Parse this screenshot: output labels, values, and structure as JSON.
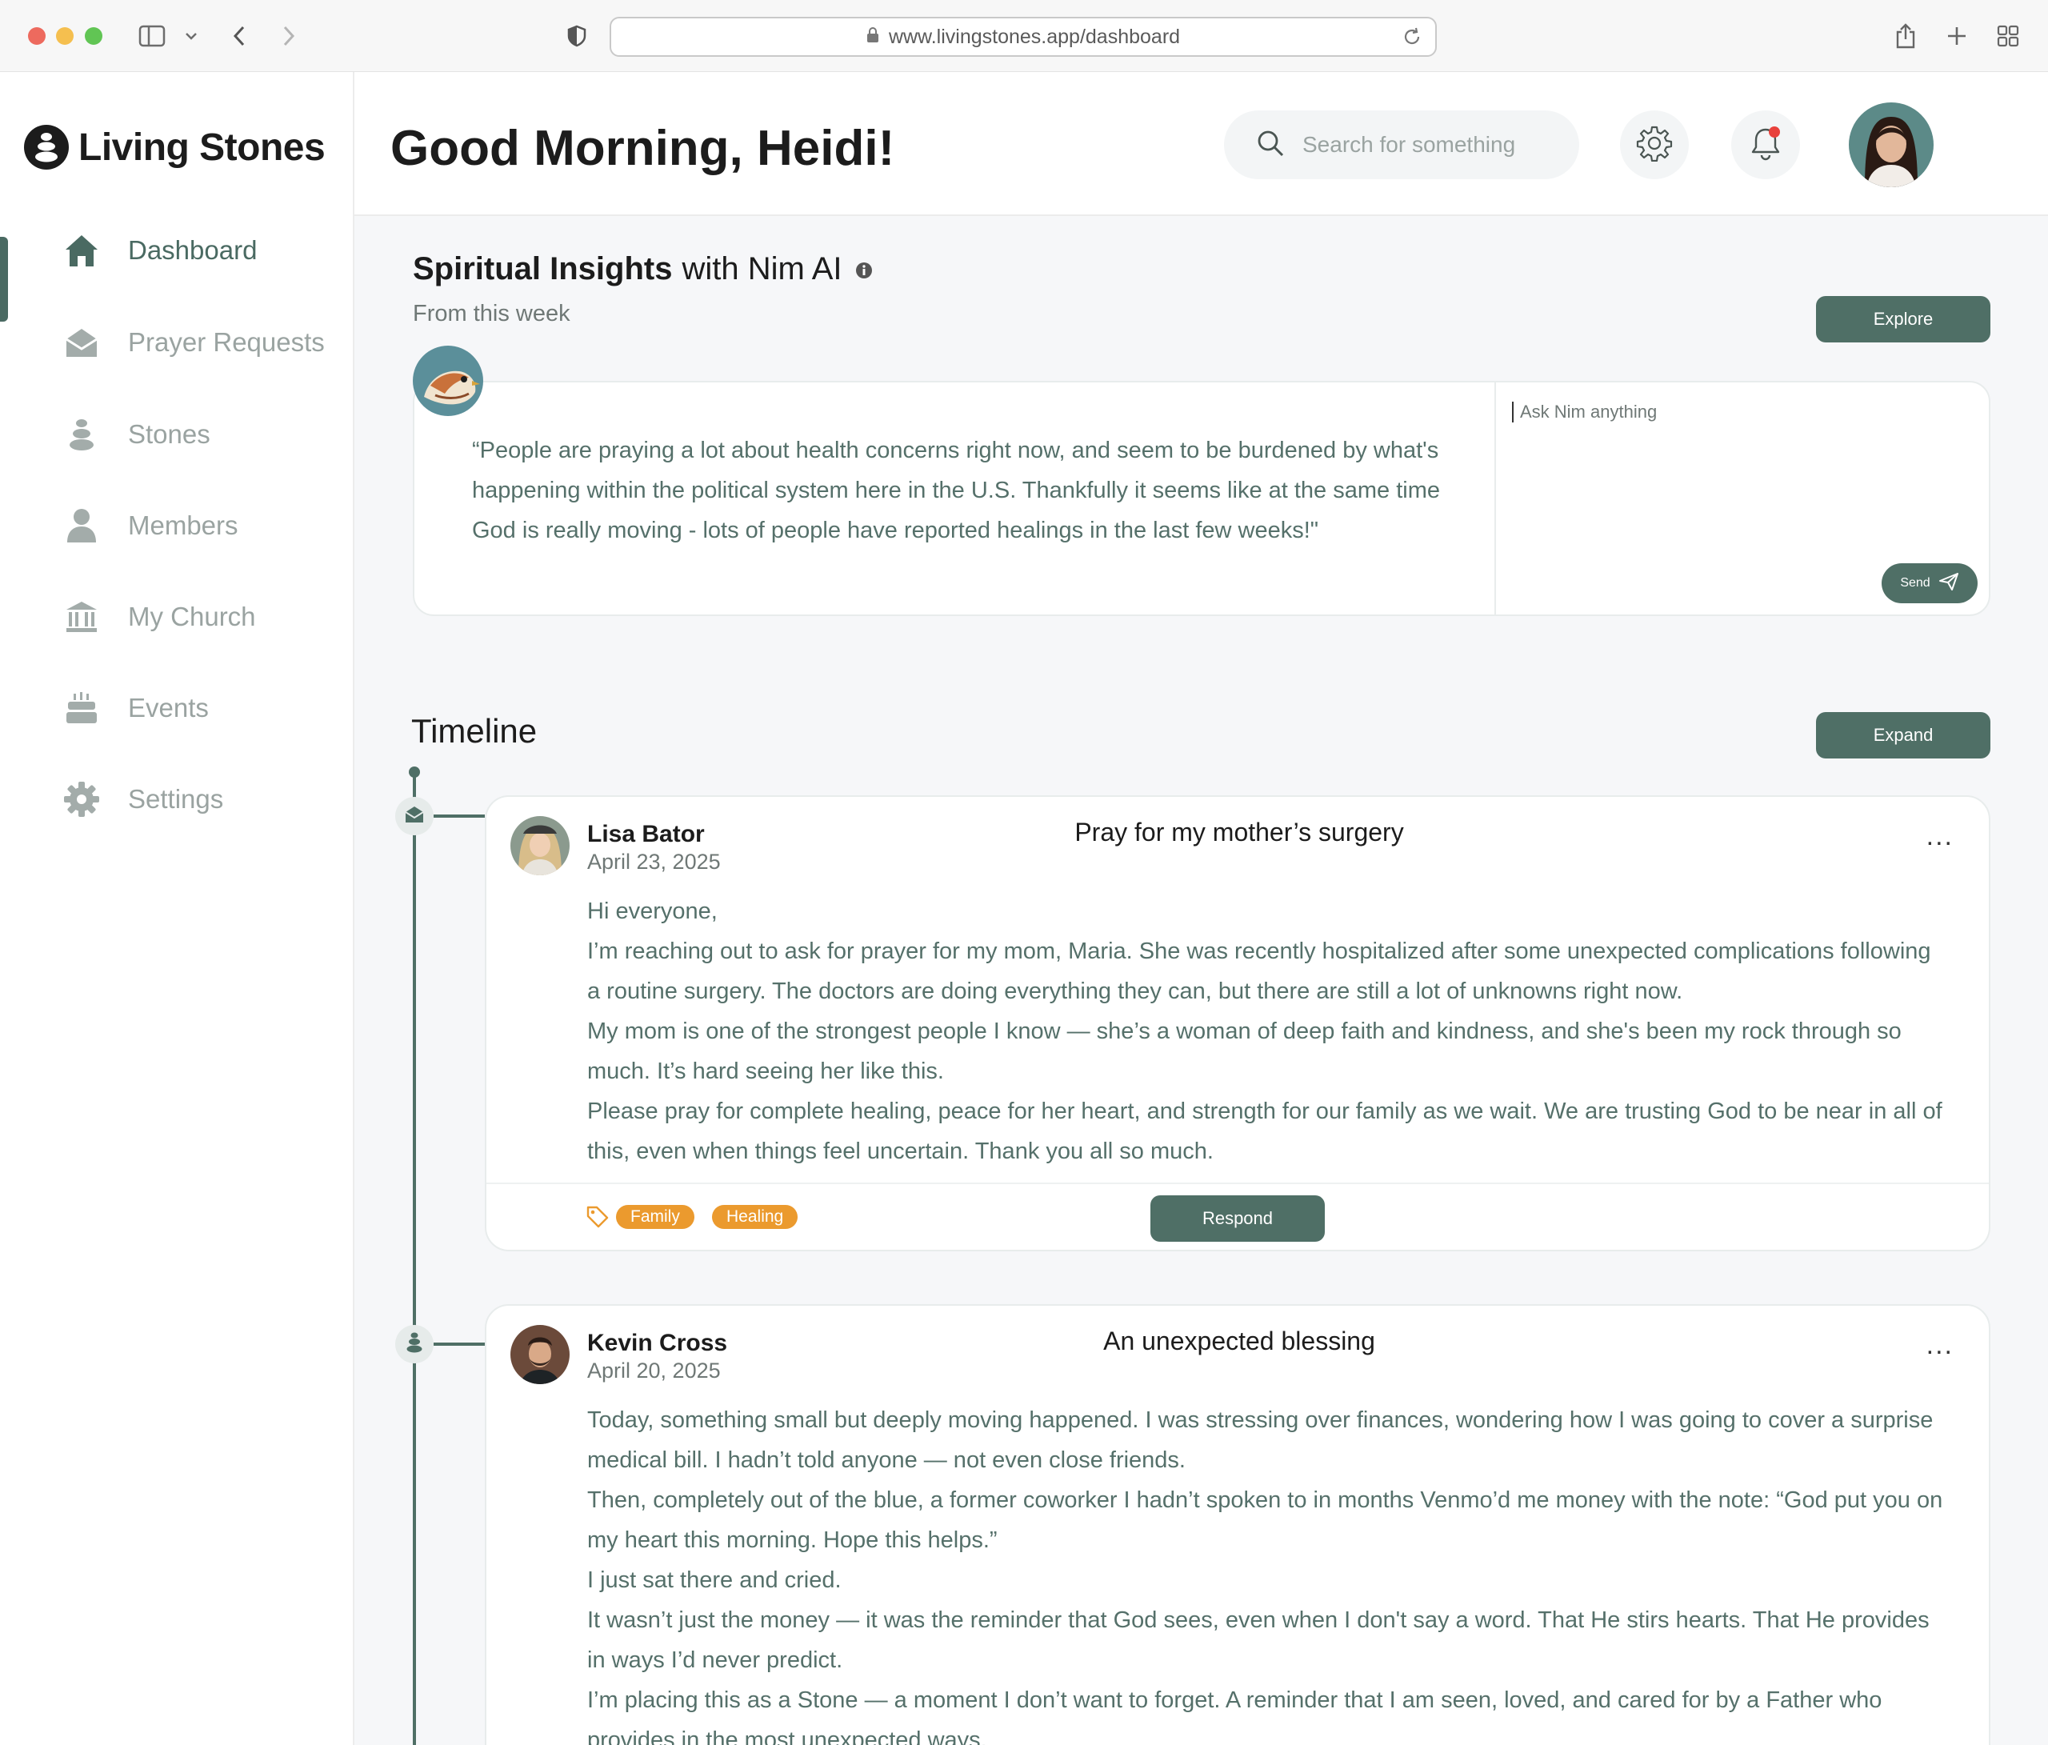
{
  "browser": {
    "url": "www.livingstones.app/dashboard"
  },
  "brand": {
    "name": "Living Stones",
    "accent": "#4f6f66",
    "tag_color": "#eb9a2e"
  },
  "sidebar": {
    "items": [
      {
        "label": "Dashboard",
        "icon": "home-icon",
        "active": true
      },
      {
        "label": "Prayer Requests",
        "icon": "envelope-icon",
        "active": false
      },
      {
        "label": "Stones",
        "icon": "stones-icon",
        "active": false
      },
      {
        "label": "Members",
        "icon": "person-icon",
        "active": false
      },
      {
        "label": "My Church",
        "icon": "church-icon",
        "active": false
      },
      {
        "label": "Events",
        "icon": "cake-icon",
        "active": false
      },
      {
        "label": "Settings",
        "icon": "gear-icon",
        "active": false
      }
    ]
  },
  "header": {
    "greeting": "Good Morning, Heidi!",
    "search_placeholder": "Search for something"
  },
  "insights": {
    "title_bold": "Spiritual Insights",
    "title_rest": "with Nim AI",
    "subtitle": "From this week",
    "explore_label": "Explore",
    "quote": "“People are praying a lot about health concerns right now, and seem to be burdened by what's happening within the political system here in the U.S. Thankfully it seems like at the same time God is really moving - lots of people have reported healings in the last few weeks!\"",
    "ask_placeholder": "Ask Nim anything",
    "send_label": "Send"
  },
  "timeline": {
    "title": "Timeline",
    "expand_label": "Expand",
    "posts": [
      {
        "author": "Lisa Bator",
        "date": "April 23, 2025",
        "title": "Pray for my mother’s surgery",
        "body": [
          "Hi everyone,",
          "I’m reaching out to ask for prayer for my mom, Maria. She was recently hospitalized after some unexpected complications following a routine surgery. The doctors are doing everything they can, but there are still a lot of unknowns right now.",
          "My mom is one of the strongest people I know — she’s a woman of deep faith and kindness, and she's been my rock through so much. It’s hard seeing her like this.",
          "Please pray for complete healing, peace for her heart, and strength for our family as we wait. We are trusting God to be near in all of this, even when things feel uncertain. Thank you all so much."
        ],
        "tags": [
          "Family",
          "Healing"
        ],
        "respond_label": "Respond",
        "more": "..."
      },
      {
        "author": "Kevin Cross",
        "date": "April 20, 2025",
        "title": "An unexpected blessing",
        "body": [
          "Today, something small but deeply moving happened. I was stressing over finances, wondering how I was going to cover a surprise medical bill. I hadn’t told anyone — not even close friends.",
          "Then, completely out of the blue, a former coworker I hadn’t spoken to in months Venmo’d me money with the note: “God put you on my heart this morning. Hope this helps.”",
          "I just sat there and cried.",
          "It wasn’t just the money — it was the reminder that God sees, even when I don't say a word. That He stirs hearts. That He provides in ways I’d never predict.",
          "I’m placing this as a Stone — a moment I don’t want to forget. A reminder that I am seen, loved, and cared for by a Father who provides in the most unexpected ways."
        ],
        "more": "..."
      }
    ]
  }
}
